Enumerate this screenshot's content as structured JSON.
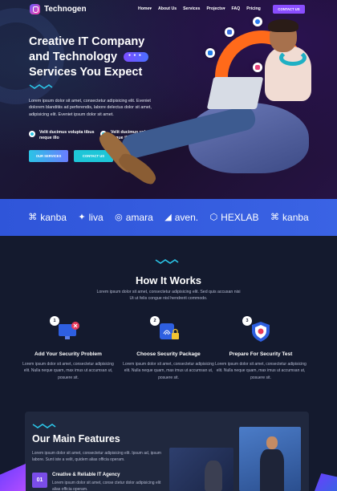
{
  "brand": {
    "name": "Technogen"
  },
  "nav": {
    "links": [
      "Home",
      "About Us",
      "Services",
      "Projects",
      "FAQ",
      "Pricing"
    ],
    "dropdown_markers": [
      "▾",
      "",
      "",
      "▾",
      "",
      ""
    ],
    "cta": "CONTACT US"
  },
  "hero": {
    "title_line1": "Creative IT Company",
    "title_line2": "and Technology",
    "title_line3": "Services You Expect",
    "description": "Lorem ipsum dolor sit amet, consectetur adipisicing elit. Eveniet dolorem blanditiis ad perferendis, labore delectus dolor sit amet, adipisicing elit. Eveniet ipsum dolor sit amet.",
    "checks": [
      "Velit ducimus volupta tibus neque illo",
      "Velit ducimus volupta tibus neque illo"
    ],
    "btn_services": "OUR SERVICES",
    "btn_contact": "CONTACT US"
  },
  "brands": [
    {
      "icon": "⌘",
      "name": "kanba"
    },
    {
      "icon": "✦",
      "name": "liva"
    },
    {
      "icon": "◎",
      "name": "amara"
    },
    {
      "icon": "◢",
      "name": "aven."
    },
    {
      "icon": "⬡",
      "name": "HEXLAB"
    },
    {
      "icon": "⌘",
      "name": "kanba"
    }
  ],
  "how": {
    "title": "How It Works",
    "subtitle": "Lorem ipsum dolor sit amet, consectetur adipisicing elit. Sed quis accusan nisi Ut ut felis congue nisl hendrerit commodo.",
    "steps": [
      {
        "num": "1",
        "title": "Add Your Security Problem",
        "desc": "Lorem ipsum dolor sit amet, consectetur adipisicing elit. Nulla neque quam, max imus ut accumsan ut, posuere sit."
      },
      {
        "num": "2",
        "title": "Choose Security Package",
        "desc": "Lorem ipsum dolor sit amet, consectetur adipisicing elit. Nulla neque quam, max imus ut accumsan ut, posuere sit."
      },
      {
        "num": "3",
        "title": "Prepare For Security Test",
        "desc": "Lorem ipsum dolor sit amet, consectetur adipisicing elit. Nulla neque quam, max imus ut accumsan ut, posuere sit."
      }
    ]
  },
  "features": {
    "title": "Our Main Features",
    "description": "Lorem ipsum dolor sit amet, consectetur adipisicing elit. Ipsum ad, ipsum labore. Sunt iste a velit, quidem alias officia operam.",
    "item_num": "01",
    "item_title": "Creative & Reliable IT Agency",
    "item_desc": "Lorem ipsum dolor sit amet, conse ctetur dolor adipisicing elit alias officia operam."
  },
  "colors": {
    "accent": "#8a4dff",
    "cyan": "#2bc4e6",
    "orange": "#ff6a1a",
    "brand_bar": "#3a63e4"
  }
}
